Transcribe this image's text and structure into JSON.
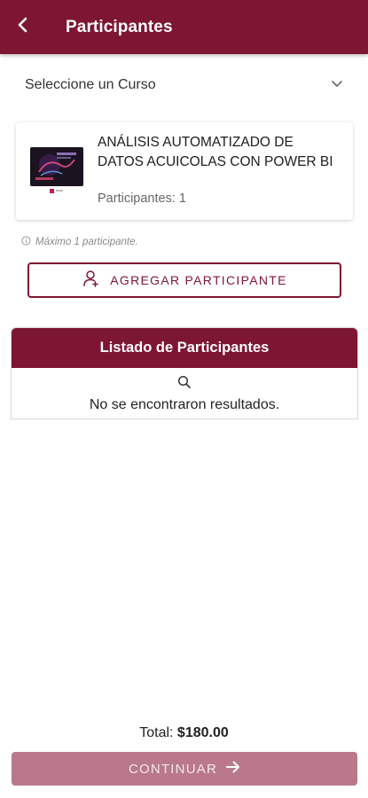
{
  "header": {
    "title": "Participantes",
    "back_icon": "chevron-left-icon"
  },
  "course_select": {
    "label": "Seleccione un Curso",
    "icon": "chevron-down-icon"
  },
  "course": {
    "name": "ANÁLISIS AUTOMATIZADO DE DATOS ACUICOLAS CON POWER BI",
    "participants_text": "Participantes: 1"
  },
  "hint": {
    "text": "Máximo 1 participante.",
    "icon": "info-icon"
  },
  "add_button": {
    "label": "AGREGAR PARTICIPANTE",
    "icon": "add-user-icon"
  },
  "participants_panel": {
    "title": "Listado de Participantes",
    "empty_text": "No se encontraron resultados.",
    "icon": "search-icon"
  },
  "footer": {
    "total_label": "Total:",
    "total_amount": "$180.00",
    "continue_label": "CONTINUAR",
    "continue_icon": "arrow-right-icon"
  },
  "colors": {
    "primary": "#7d1632",
    "button_disabled": "#b9798b"
  }
}
